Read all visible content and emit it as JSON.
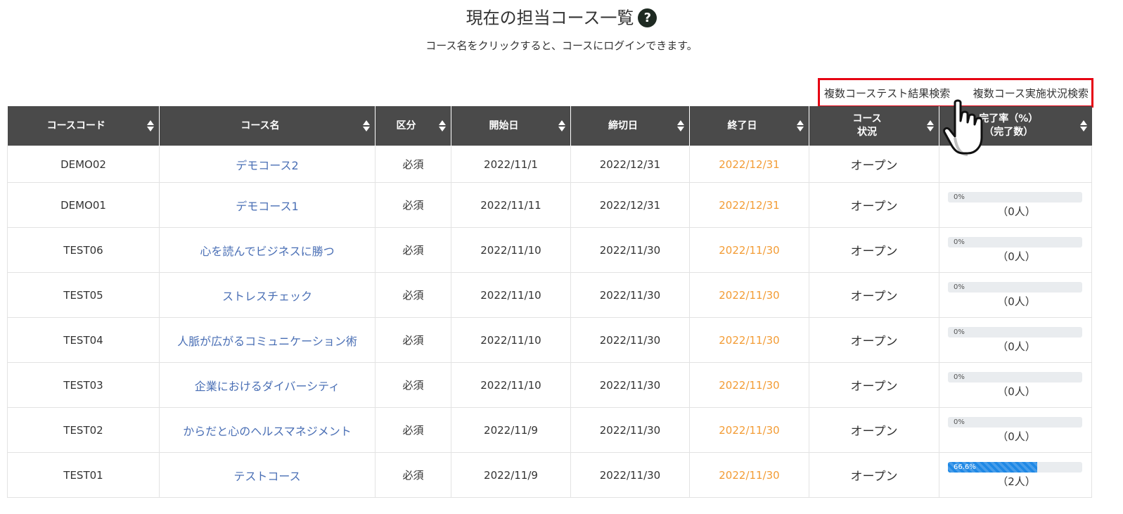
{
  "header": {
    "title": "現在の担当コース一覧",
    "help_icon": "?",
    "subtitle": "コース名をクリックすると、コースにログインできます。"
  },
  "search_links": {
    "multi_test_results": "複数コーステスト結果検索",
    "multi_progress": "複数コース実施状況検索"
  },
  "table": {
    "headers": [
      "コースコード",
      "コース名",
      "区分",
      "開始日",
      "締切日",
      "終了日",
      "コース\n状況",
      "完了率（%）\n（完了数）"
    ],
    "rows": [
      {
        "code": "DEMO02",
        "name": "デモコース2",
        "category": "必須",
        "start": "2022/11/1",
        "deadline": "2022/12/31",
        "end": "2022/12/31",
        "status": "オープン",
        "progress_label": "",
        "progress_fraction": null,
        "completed": ""
      },
      {
        "code": "DEMO01",
        "name": "デモコース1",
        "category": "必須",
        "start": "2022/11/11",
        "deadline": "2022/12/31",
        "end": "2022/12/31",
        "status": "オープン",
        "progress_label": "0%",
        "progress_fraction": 0,
        "completed": "（0人）"
      },
      {
        "code": "TEST06",
        "name": "心を読んでビジネスに勝つ",
        "category": "必須",
        "start": "2022/11/10",
        "deadline": "2022/11/30",
        "end": "2022/11/30",
        "status": "オープン",
        "progress_label": "0%",
        "progress_fraction": 0,
        "completed": "（0人）"
      },
      {
        "code": "TEST05",
        "name": "ストレスチェック",
        "category": "必須",
        "start": "2022/11/10",
        "deadline": "2022/11/30",
        "end": "2022/11/30",
        "status": "オープン",
        "progress_label": "0%",
        "progress_fraction": 0,
        "completed": "（0人）"
      },
      {
        "code": "TEST04",
        "name": "人脈が広がるコミュニケーション術",
        "category": "必須",
        "start": "2022/11/10",
        "deadline": "2022/11/30",
        "end": "2022/11/30",
        "status": "オープン",
        "progress_label": "0%",
        "progress_fraction": 0,
        "completed": "（0人）"
      },
      {
        "code": "TEST03",
        "name": "企業におけるダイバーシティ",
        "category": "必須",
        "start": "2022/11/10",
        "deadline": "2022/11/30",
        "end": "2022/11/30",
        "status": "オープン",
        "progress_label": "0%",
        "progress_fraction": 0,
        "completed": "（0人）"
      },
      {
        "code": "TEST02",
        "name": "からだと心のヘルスマネジメント",
        "category": "必須",
        "start": "2022/11/9",
        "deadline": "2022/11/30",
        "end": "2022/11/30",
        "status": "オープン",
        "progress_label": "0%",
        "progress_fraction": 0,
        "completed": "（0人）"
      },
      {
        "code": "TEST01",
        "name": "テストコース",
        "category": "必須",
        "start": "2022/11/9",
        "deadline": "2022/11/30",
        "end": "2022/11/30",
        "status": "オープン",
        "progress_label": "66.6%",
        "progress_fraction": 0.666,
        "completed": "（2人）"
      }
    ]
  },
  "colors": {
    "header_bg": "#4a4a4a",
    "link": "#4a6fb5",
    "end_date": "#f39c35",
    "highlight_box": "#e60012",
    "progress_fill": "#1e88e5",
    "progress_track": "#e9ecef"
  },
  "icons": {
    "pointer": "hand-pointer-icon",
    "help": "question-circle-icon",
    "sort": "sort-icon"
  }
}
